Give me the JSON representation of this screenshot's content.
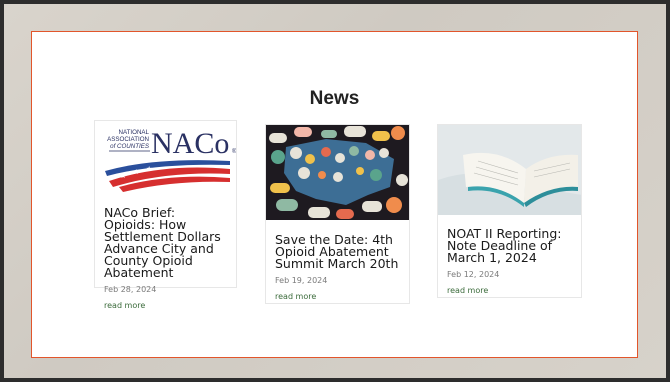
{
  "heading": "News",
  "cards": [
    {
      "logo_small": "NATIONAL\nASSOCIATION\nof COUNTIES",
      "logo_big": "NACo",
      "title": "NACo Brief: Opioids: How Settlement Dollars Advance City and County Opioid Abatement",
      "date": "Feb 28, 2024",
      "more": "read more"
    },
    {
      "title": "Save the Date: 4th Opioid Abatement Summit March 20th",
      "date": "Feb 19, 2024",
      "more": "read more"
    },
    {
      "title": "NOAT II Reporting: Note Deadline of March 1, 2024",
      "date": "Feb 12, 2024",
      "more": "read more"
    }
  ]
}
